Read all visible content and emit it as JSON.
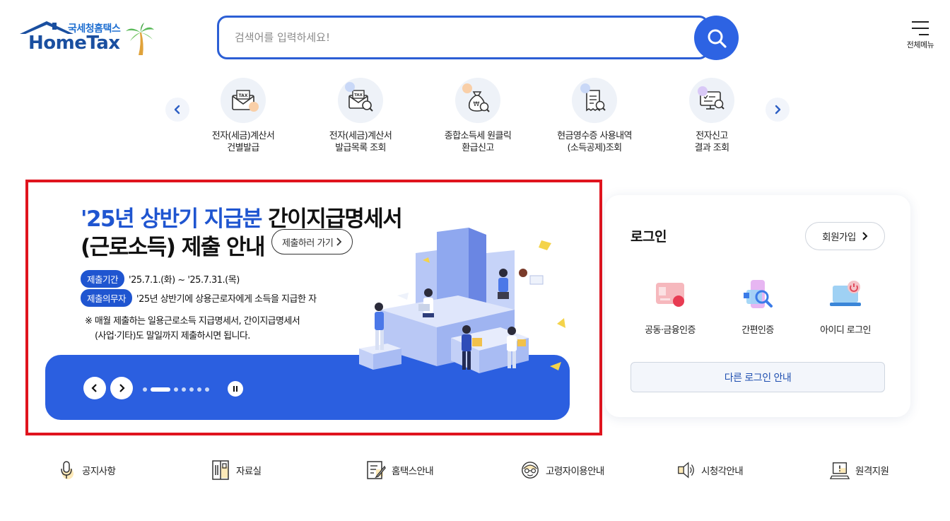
{
  "header": {
    "org_name": "국세청홈택스",
    "brand": "HomeTax",
    "search_placeholder": "검색어를 입력하세요!",
    "all_menu_label": "전체메뉴"
  },
  "quick_menu": {
    "items": [
      {
        "line1": "전자(세금)계산서",
        "line2": "건별발급",
        "icon": "tax-envelope-icon"
      },
      {
        "line1": "전자(세금)계산서",
        "line2": "발급목록 조회",
        "icon": "tax-search-icon"
      },
      {
        "line1": "종합소득세 원클릭",
        "line2": "환급신고",
        "icon": "money-bag-icon"
      },
      {
        "line1": "현금영수증 사용내역",
        "line2": "(소득공제)조회",
        "icon": "receipt-search-icon"
      },
      {
        "line1": "전자신고",
        "line2": "결과 조회",
        "icon": "monitor-check-icon"
      }
    ]
  },
  "banner": {
    "title_blue": "'25년 상반기 지급분",
    "title_dark": "간이지급명세서",
    "title_line2": "(근로소득) 제출 안내",
    "go_button": "제출하러 가기",
    "period_chip": "제출기간",
    "period_text": "'25.7.1.(화) ~ '25.7.31.(목)",
    "duty_chip": "제출의무자",
    "duty_text": "'25년 상반기에 상용근로자에게 소득을 지급한 자",
    "note_line1": "※ 매월 제출하는 일용근로소득 지급명세서, 간이지급명세서",
    "note_line2": "(사업·기타)도 말일까지 제출하시면 됩니다.",
    "slide_count": 7,
    "active_slide": 2
  },
  "login": {
    "title": "로그인",
    "join_button": "회원가입",
    "options": [
      {
        "label": "공동·금융인증",
        "icon": "certificate-card-icon"
      },
      {
        "label": "간편인증",
        "icon": "phone-search-icon"
      },
      {
        "label": "아이디 로그인",
        "icon": "laptop-power-icon"
      }
    ],
    "other_button": "다른 로그인 안내"
  },
  "bottom_links": [
    {
      "label": "공지사항",
      "icon": "microphone-icon"
    },
    {
      "label": "자료실",
      "icon": "archive-icon"
    },
    {
      "label": "홈택스안내",
      "icon": "document-pen-icon"
    },
    {
      "label": "고령자이용안내",
      "icon": "elder-icon"
    },
    {
      "label": "시청각안내",
      "icon": "speaker-icon"
    },
    {
      "label": "원격지원",
      "icon": "remote-support-icon"
    }
  ],
  "colors": {
    "primary": "#2d63e3",
    "brand_navy": "#1a4fa0",
    "highlight_border": "#e0141e"
  }
}
